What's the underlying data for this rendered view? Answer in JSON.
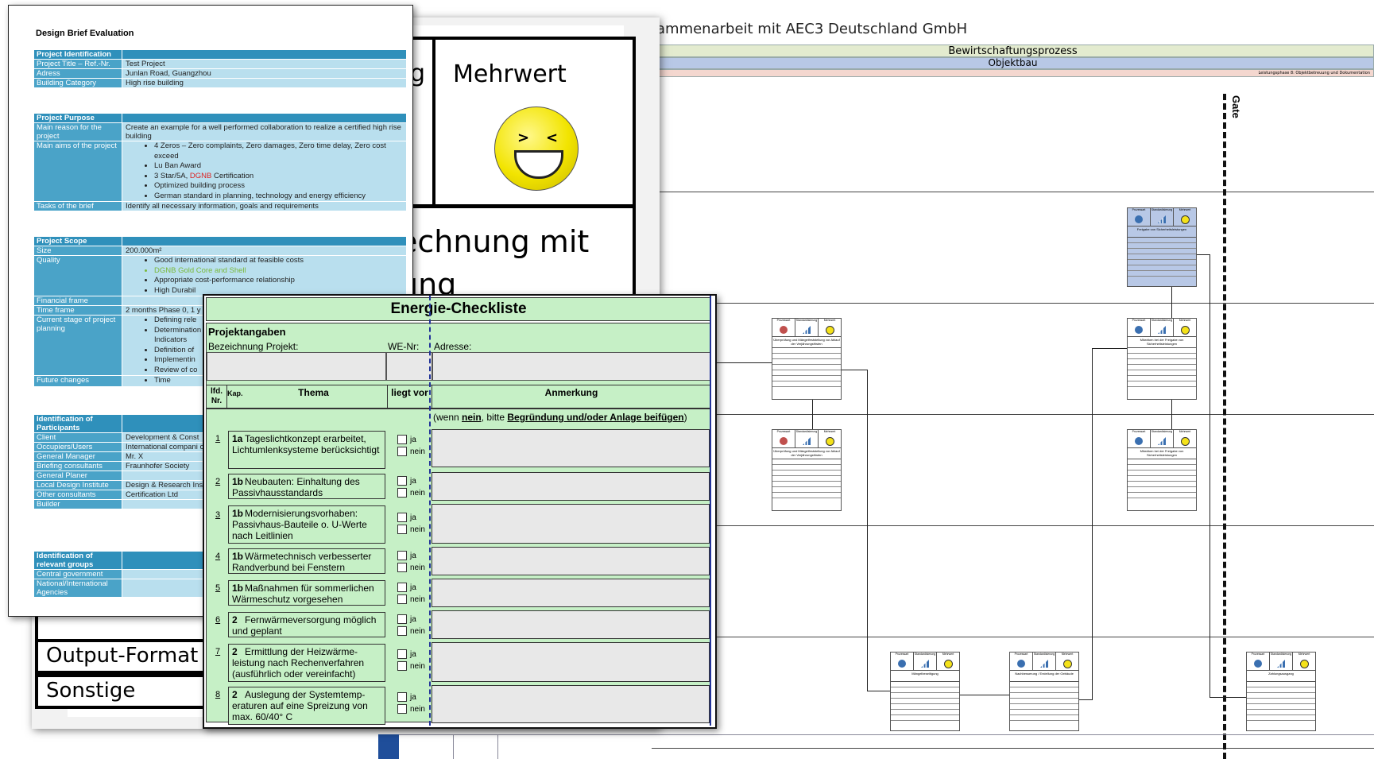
{
  "background_doc": {
    "title": "ammenarbeit mit AEC3 Deutschland GmbH",
    "band_top": "Bewirtschaftungsprozess",
    "band_mid": "Objektbau",
    "band_phase": "Leistungsphase 8: Objektbetreuung und Dokumentation",
    "gate_label": "Gate",
    "box_headers": [
      "Prozessart",
      "Standardisierung",
      "Mehrwert"
    ],
    "boxes": [
      {
        "title": "Freigabe von Sicherheitsleistungen"
      },
      {
        "title": "Überprüfung und Mängelfeststellung vor Ablauf der Verjährungsfristen"
      },
      {
        "title": "Mitwirken bei der Freigabe von Sicherheitsleistungen"
      },
      {
        "title": "Überprüfung und Mängelfeststellung vor Ablauf der Verjährungsfristen"
      },
      {
        "title": "Mitwirken bei der Freigabe von Sicherheitsleistungen"
      },
      {
        "title": "Mängelbeseitigung"
      },
      {
        "title": "Nachbesserung / Erstellung der Gebäude"
      },
      {
        "title": "Zahlungsausgang"
      }
    ]
  },
  "middle_doc": {
    "left_partial": "g",
    "mehrwert_label": "Mehrwert",
    "bottom_text_line1": "echnung mit",
    "bottom_text_line2": "ung",
    "row_output": "Output-Format",
    "row_sonstige": "Sonstige"
  },
  "brief": {
    "title": "Design Brief Evaluation",
    "identification": {
      "header": "Project Identification",
      "rows": [
        {
          "k": "Project Title – Ref.-Nr.",
          "v": "Test Project"
        },
        {
          "k": "Adress",
          "v": "Junlan Road, Guangzhou"
        },
        {
          "k": "Building Category",
          "v": "High rise building"
        }
      ]
    },
    "purpose": {
      "header": "Project Purpose",
      "main_reason_k": "Main reason for the project",
      "main_reason_v": "Create an example for a well performed collaboration to realize a certified high rise building",
      "aims_k": "Main aims of the project",
      "aims": [
        "4 Zeros – Zero complaints, Zero damages, Zero time delay, Zero cost exceed",
        "Lu Ban Award",
        "3 Star/5A, ",
        "Optimized building process",
        "German standard in planning, technology and energy efficiency"
      ],
      "aims_dgnb": "DGNB",
      "aims_cert": " Certification",
      "tasks_k": "Tasks of the brief",
      "tasks_v": "Identify all necessary information, goals and requirements"
    },
    "scope": {
      "header": "Project Scope",
      "size_k": "Size",
      "size_v": "200.000m²",
      "quality_k": "Quality",
      "quality": [
        "Good international standard at feasible costs",
        "DGNB Gold Core and Shell",
        "Appropriate cost-performance relationship",
        "High Durabil"
      ],
      "financial_k": "Financial frame",
      "financial_v": "",
      "time_k": "Time frame",
      "time_v": "2 months Phase 0, 1 y",
      "stage_k": "Current stage of project planning",
      "stage": [
        "Defining rele",
        "Determination",
        "Indicators",
        "Definition of",
        "Implementin",
        "Review of co"
      ],
      "future_k": "Future changes",
      "future": [
        "Time"
      ]
    },
    "participants": {
      "header": "Identification of Participants",
      "rows": [
        {
          "k": "Client",
          "v": "Development & Const"
        },
        {
          "k": "Occupiers/Users",
          "v": "International compani companies"
        },
        {
          "k": "General Manager",
          "v": "Mr. X"
        },
        {
          "k": "Briefing consultants",
          "v": "Fraunhofer Society"
        },
        {
          "k": "General Planer",
          "v": ""
        },
        {
          "k": "Local Design Institute",
          "v": "Design & Research Ins"
        },
        {
          "k": "Other consultants",
          "v": "Certification Ltd"
        },
        {
          "k": "Builder",
          "v": ""
        }
      ]
    },
    "groups": {
      "header": "Identification of relevant groups",
      "rows": [
        {
          "k": "Central government",
          "v": ""
        },
        {
          "k": "National/International Agencies",
          "v": ""
        }
      ]
    }
  },
  "checklist": {
    "title": "Energie-Checkliste",
    "projektangaben": "Projektangaben",
    "bezeichnung": "Bezeichnung Projekt:",
    "we_nr": "WE-Nr:",
    "adresse": "Adresse:",
    "col_lfd": "lfd. Nr.",
    "col_kap": "Kap.",
    "col_thema": "Thema",
    "col_liegt": "liegt vor",
    "col_anm": "Anmerkung",
    "note_pre": "(wenn ",
    "note_nein": "nein",
    "note_mid": ", bitte ",
    "note_bold": "Begründung und/oder Anlage beifügen",
    "note_post": ")",
    "ja": "ja",
    "nein": "nein",
    "rows": [
      {
        "nr": "1",
        "kap": "1a",
        "text": "Tageslichtkonzept erarbeitet, Lichtumlenksysteme berücksichtigt"
      },
      {
        "nr": "2",
        "kap": "1b",
        "text": "Neubauten: Einhaltung des Passivhausstandards"
      },
      {
        "nr": "3",
        "kap": "1b",
        "text": "Modernisierungsvorhaben: Passivhaus-Bauteile o. U-Werte nach Leitlinien"
      },
      {
        "nr": "4",
        "kap": "1b",
        "text": "Wärmetechnisch verbesserter Randverbund bei Fenstern"
      },
      {
        "nr": "5",
        "kap": "1b",
        "text": "Maßnahmen für sommerlichen Wärmeschutz vorgesehen"
      },
      {
        "nr": "6",
        "kap": "2",
        "text": "Fernwärmeversorgung möglich und geplant"
      },
      {
        "nr": "7",
        "kap": "2",
        "text": "Ermittlung der Heizwärme-leistung nach Rechenverfahren (ausführlich oder vereinfacht)"
      },
      {
        "nr": "8",
        "kap": "2",
        "text": "Auslegung der Systemtemp-eraturen auf eine Spreizung von max. 60/40° C"
      }
    ]
  }
}
